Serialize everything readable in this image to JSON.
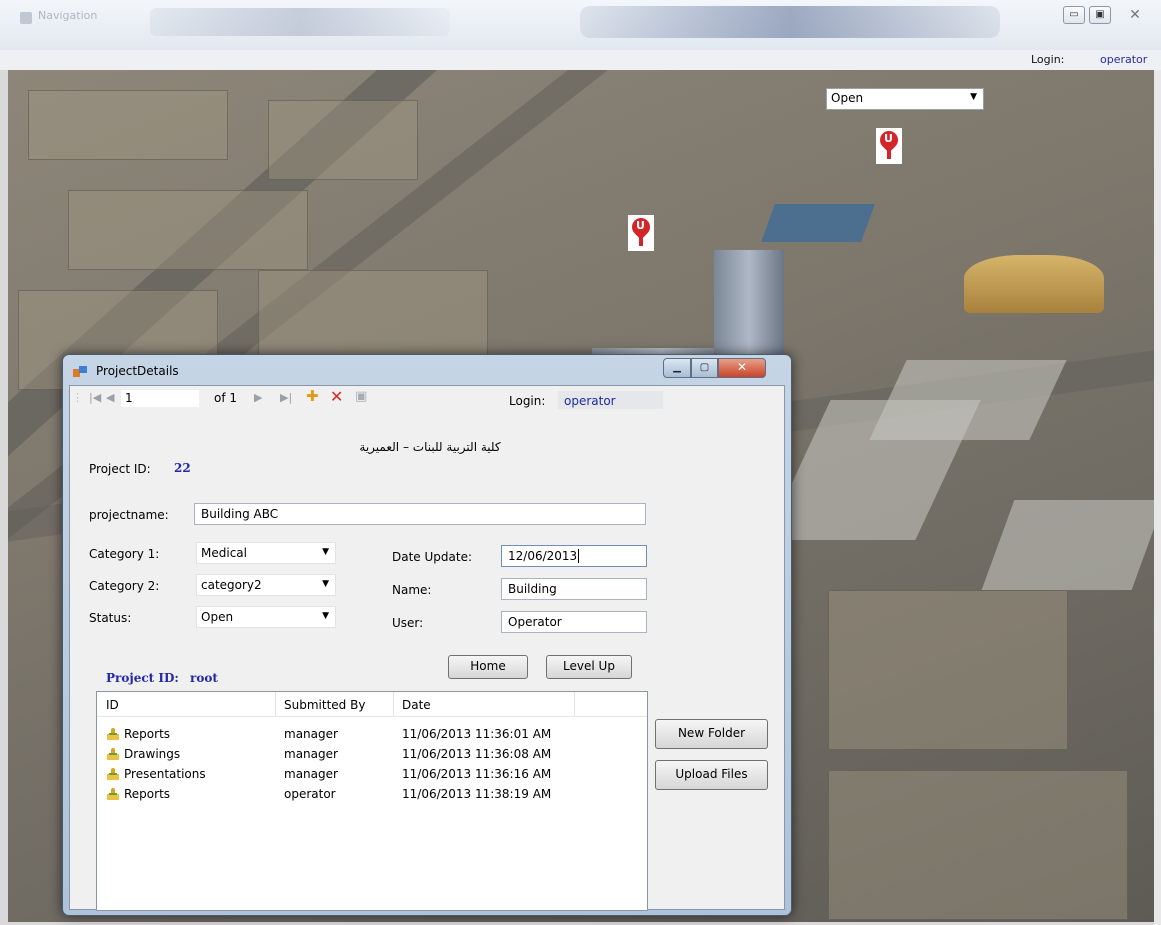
{
  "window": {
    "title": "Navigation",
    "login_label": "Login:",
    "login_value": "operator"
  },
  "map": {
    "status_filter": {
      "selected": "Open"
    },
    "markers": [
      {
        "glyph": "U"
      },
      {
        "glyph": "U"
      }
    ]
  },
  "dialog": {
    "title": "ProjectDetails",
    "toolbar": {
      "position": "1",
      "count": "of 1",
      "login_label": "Login:",
      "login_value": "operator"
    },
    "arabic_title": "كلية التربية للبنات – العميرية",
    "project_id_label": "Project ID:",
    "project_id_value": "22",
    "projectname_label": "projectname:",
    "projectname_value": "Building ABC",
    "category1_label": "Category 1:",
    "category1_value": "Medical",
    "category2_label": "Category 2:",
    "category2_value": "category2",
    "status_label": "Status:",
    "status_value": "Open",
    "date_update_label": "Date Update:",
    "date_update_value": "12/06/2013",
    "name_label": "Name:",
    "name_value": "Building",
    "user_label": "User:",
    "user_value": "Operator",
    "home_button": "Home",
    "level_up_button": "Level Up",
    "root_label": "Project ID:",
    "root_value": "root",
    "new_folder_button": "New Folder",
    "upload_files_button": "Upload Files",
    "list": {
      "columns": [
        "ID",
        "Submitted By",
        "Date"
      ],
      "rows": [
        {
          "id": "Reports",
          "submitted_by": "manager",
          "date": "11/06/2013 11:36:01 AM"
        },
        {
          "id": "Drawings",
          "submitted_by": "manager",
          "date": "11/06/2013 11:36:08 AM"
        },
        {
          "id": "Presentations",
          "submitted_by": "manager",
          "date": "11/06/2013 11:36:16 AM"
        },
        {
          "id": "Reports",
          "submitted_by": "operator",
          "date": "11/06/2013 11:38:19 AM"
        }
      ]
    }
  },
  "colors": {
    "accent_blue": "#2427a8",
    "close_red": "#c8442a",
    "marker_red": "#d2262b"
  }
}
